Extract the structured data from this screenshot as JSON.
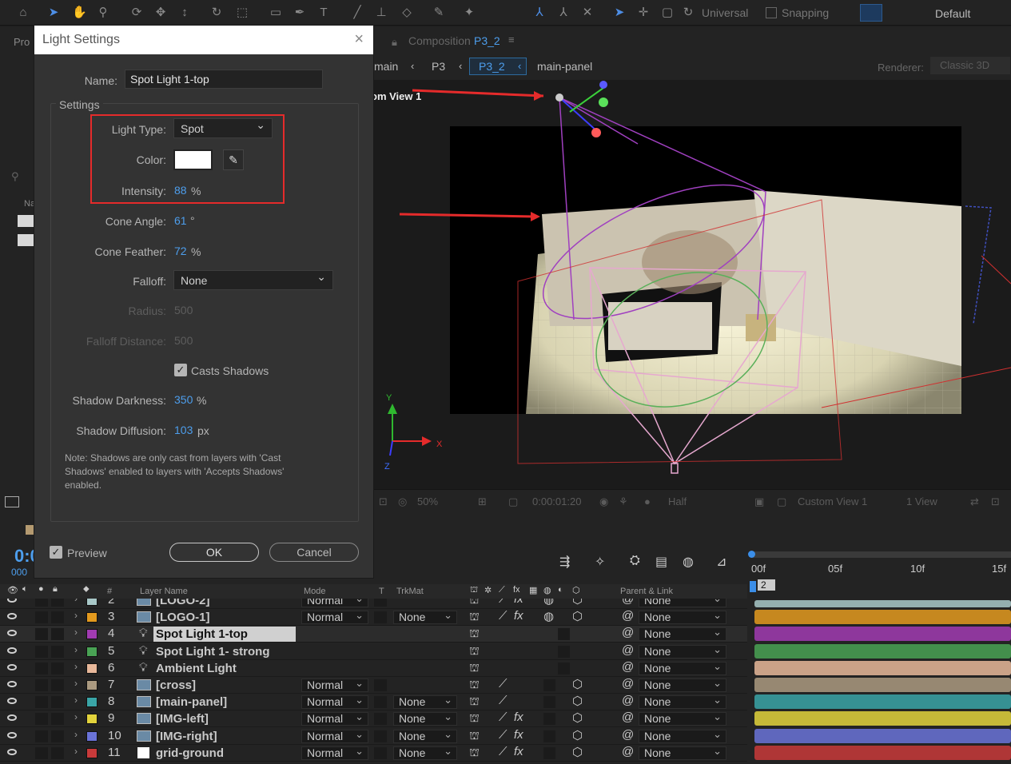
{
  "toolbar": {
    "universal_label": "Universal",
    "snapping_label": "Snapping",
    "workspace": "Default"
  },
  "left_panel": {
    "tab_label": "Pro",
    "col_label": "Na"
  },
  "composition": {
    "tab_prefix": "Composition",
    "tab_name": "P3_2",
    "breadcrumb": [
      "main",
      "P3",
      "P3_2",
      "main-panel"
    ],
    "renderer_label": "Renderer:",
    "renderer_value": "Classic 3D",
    "view_label": "om View 1"
  },
  "viewer_footer": {
    "zoom": "50%",
    "timecode": "0:00:01:20",
    "resolution": "Half",
    "view": "Custom View 1",
    "views": "1 View"
  },
  "axes": {
    "y": "Y",
    "x": "X",
    "z": "Z"
  },
  "dialog": {
    "title": "Light Settings",
    "name_label": "Name:",
    "name_value": "Spot Light 1-top",
    "settings_label": "Settings",
    "light_type_label": "Light Type:",
    "light_type_value": "Spot",
    "color_label": "Color:",
    "color_value": "#ffffff",
    "intensity_label": "Intensity:",
    "intensity_value": "88",
    "intensity_unit": "%",
    "cone_angle_label": "Cone Angle:",
    "cone_angle_value": "61",
    "cone_angle_unit": "°",
    "cone_feather_label": "Cone Feather:",
    "cone_feather_value": "72",
    "cone_feather_unit": "%",
    "falloff_label": "Falloff:",
    "falloff_value": "None",
    "radius_label": "Radius:",
    "radius_value": "500",
    "falloff_distance_label": "Falloff Distance:",
    "falloff_distance_value": "500",
    "casts_shadows_label": "Casts Shadows",
    "shadow_darkness_label": "Shadow Darkness:",
    "shadow_darkness_value": "350",
    "shadow_darkness_unit": "%",
    "shadow_diffusion_label": "Shadow Diffusion:",
    "shadow_diffusion_value": "103",
    "shadow_diffusion_unit": "px",
    "note": "Note: Shadows are only cast from layers with 'Cast Shadows' enabled to layers with 'Accepts Shadows' enabled.",
    "preview_label": "Preview",
    "ok_label": "OK",
    "cancel_label": "Cancel"
  },
  "timeline": {
    "current_time": "0:0",
    "frame_count": "000",
    "ruler": [
      "00f",
      "05f",
      "10f",
      "15f"
    ],
    "work_marker": "2",
    "headers": {
      "num": "#",
      "layer_name": "Layer Name",
      "mode": "Mode",
      "t": "T",
      "trkmat": "TrkMat",
      "parent": "Parent & Link"
    },
    "layers": [
      {
        "num": "2",
        "name": "[LOGO-2]",
        "mode": "Normal",
        "trkmat": "",
        "parent": "None",
        "color": "#a8c8c8"
      },
      {
        "num": "3",
        "name": "[LOGO-1]",
        "mode": "Normal",
        "trkmat": "None",
        "parent": "None",
        "color": "#e39a1e"
      },
      {
        "num": "4",
        "name": "Spot Light 1-top",
        "mode": "",
        "trkmat": "",
        "parent": "None",
        "color": "#a13bb1"
      },
      {
        "num": "5",
        "name": "Spot Light 1- strong",
        "mode": "",
        "trkmat": "",
        "parent": "None",
        "color": "#49a254"
      },
      {
        "num": "6",
        "name": "Ambient Light",
        "mode": "",
        "trkmat": "",
        "parent": "None",
        "color": "#e8b89a"
      },
      {
        "num": "7",
        "name": "[cross]",
        "mode": "Normal",
        "trkmat": "",
        "parent": "None",
        "color": "#ab9a80"
      },
      {
        "num": "8",
        "name": "[main-panel]",
        "mode": "Normal",
        "trkmat": "None",
        "parent": "None",
        "color": "#3aa5a7"
      },
      {
        "num": "9",
        "name": "[IMG-left]",
        "mode": "Normal",
        "trkmat": "None",
        "parent": "None",
        "color": "#e2d33c"
      },
      {
        "num": "10",
        "name": "[IMG-right]",
        "mode": "Normal",
        "trkmat": "None",
        "parent": "None",
        "color": "#6a73d8"
      },
      {
        "num": "11",
        "name": "grid-ground",
        "mode": "Normal",
        "trkmat": "None",
        "parent": "None",
        "color": "#c83a3a"
      }
    ]
  },
  "colors": {
    "accent": "#4d9eed",
    "highlight_box": "#e52b2b"
  }
}
